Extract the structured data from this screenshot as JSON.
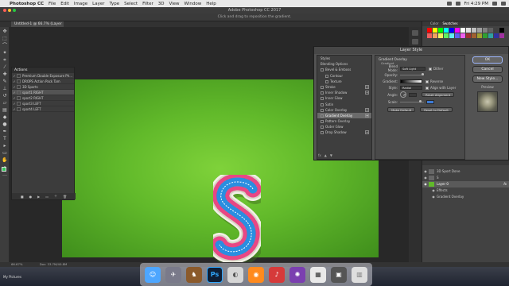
{
  "menubar": {
    "app": "Photoshop CC",
    "items": [
      "File",
      "Edit",
      "Image",
      "Layer",
      "Type",
      "Select",
      "Filter",
      "3D",
      "View",
      "Window",
      "Help"
    ],
    "clock": "Fri 4:29 PM"
  },
  "app_title": "Adobe Photoshop CC 2017",
  "options_hint": "Click and drag to reposition the gradient.",
  "doc_tab": "Untitled-1 @ 66.7% (Layer 0, RGB/8)",
  "actions": {
    "title": "Actions",
    "rows": [
      {
        "label": "Premium Double Exposure Ph...",
        "checked": true,
        "selected": false
      },
      {
        "label": "DROPS Action Pack Tam",
        "checked": true,
        "selected": false
      },
      {
        "label": "3D Sports",
        "checked": true,
        "selected": false
      },
      {
        "label": "sport1 RIGHT",
        "checked": true,
        "selected": true
      },
      {
        "label": "sport2 RIGHT",
        "checked": true,
        "selected": false
      },
      {
        "label": "sport3 LEFT",
        "checked": true,
        "selected": false
      },
      {
        "label": "sport4 LEFT",
        "checked": true,
        "selected": false
      }
    ]
  },
  "layer_style": {
    "title": "Layer Style",
    "styles": [
      {
        "label": "Styles",
        "sub": false,
        "active": false,
        "plus": false
      },
      {
        "label": "Blending Options",
        "sub": false,
        "active": false,
        "plus": false
      },
      {
        "label": "Bevel & Emboss",
        "sub": false,
        "active": false,
        "plus": false
      },
      {
        "label": "Contour",
        "sub": true,
        "active": false,
        "plus": false
      },
      {
        "label": "Texture",
        "sub": true,
        "active": false,
        "plus": false
      },
      {
        "label": "Stroke",
        "sub": false,
        "active": false,
        "plus": true
      },
      {
        "label": "Inner Shadow",
        "sub": false,
        "active": false,
        "plus": true
      },
      {
        "label": "Inner Glow",
        "sub": false,
        "active": false,
        "plus": false
      },
      {
        "label": "Satin",
        "sub": false,
        "active": false,
        "plus": false
      },
      {
        "label": "Color Overlay",
        "sub": false,
        "active": false,
        "plus": true
      },
      {
        "label": "Gradient Overlay",
        "sub": false,
        "active": true,
        "plus": true
      },
      {
        "label": "Pattern Overlay",
        "sub": false,
        "active": false,
        "plus": false
      },
      {
        "label": "Outer Glow",
        "sub": false,
        "active": false,
        "plus": false
      },
      {
        "label": "Drop Shadow",
        "sub": false,
        "active": false,
        "plus": true
      }
    ],
    "panel_title": "Gradient Overlay",
    "panel_sub": "Gradient",
    "blend_mode_label": "Blend Mode:",
    "blend_mode": "Soft Light",
    "dither": "Dither",
    "opacity_label": "Opacity:",
    "gradient_label": "Gradient:",
    "reverse": "Reverse",
    "style_label": "Style:",
    "style": "Radial",
    "align": "Align with Layer",
    "angle_label": "Angle:",
    "reset_alignment": "Reset Alignment",
    "scale_label": "Scale:",
    "make_default": "Make Default",
    "reset_default": "Reset to Default",
    "ok": "OK",
    "cancel": "Cancel",
    "new_style": "New Style...",
    "preview": "Preview"
  },
  "panel_tabs": [
    "Color",
    "Swatches"
  ],
  "layers": [
    {
      "label": "3D Sport Done",
      "selected": false,
      "fx": false
    },
    {
      "label": "S",
      "selected": false,
      "fx": false
    },
    {
      "label": "Layer 0",
      "selected": true,
      "fx": true
    },
    {
      "label": "Effects",
      "selected": false,
      "fx": false
    },
    {
      "label": "Gradient Overlay",
      "selected": false,
      "fx": false
    }
  ],
  "status": {
    "zoom": "66.67%",
    "doc": "Doc: 33.7M/40.8M"
  },
  "desktop_folder": "My Pictures",
  "colors": {
    "canvas_green": "#61b92a",
    "letter_pink": "#e33a7a",
    "letter_blue": "#2a8ee0",
    "accent": "#3e7bd6"
  }
}
